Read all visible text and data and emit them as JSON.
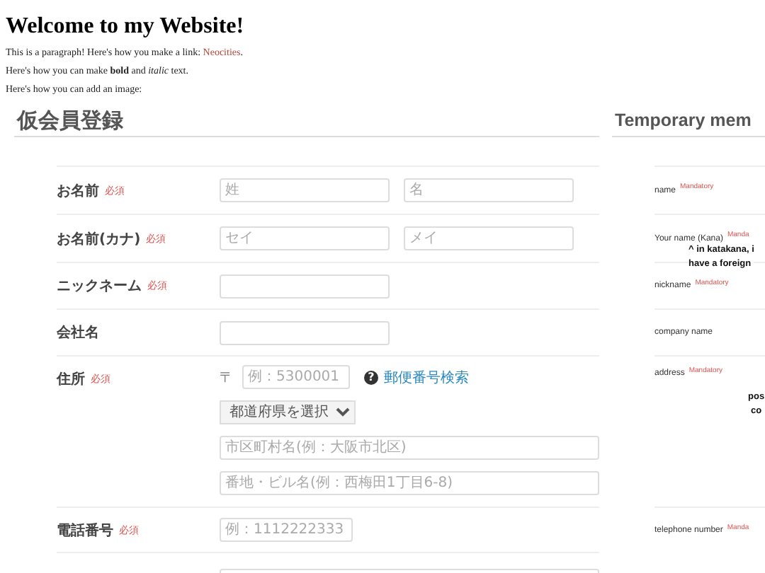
{
  "heading": "Welcome to my Website!",
  "intro": {
    "text": "This is a paragraph! Here's how you make a link: ",
    "link": "Neocities",
    "after": "."
  },
  "paragraphs": [
    "Here's how you can make **bold** and *italic* text.",
    "Here's how you can add an image:"
  ],
  "form_ja": {
    "title": "仮会員登録",
    "rows": [
      {
        "kind": "fields",
        "label": "お名前",
        "badge": "必須",
        "fields": [
          {
            "kind": "short",
            "placeholder": "姓"
          },
          {
            "kind": "short",
            "placeholder": "名"
          }
        ]
      },
      {
        "kind": "fields",
        "label": "お名前(カナ)",
        "badge": "必須",
        "fields": [
          {
            "kind": "short",
            "placeholder": "セイ"
          },
          {
            "kind": "short",
            "placeholder": "メイ"
          }
        ]
      },
      {
        "kind": "fields",
        "label": "ニックネーム",
        "badge": "必須",
        "fields": [
          {
            "kind": "short"
          }
        ]
      },
      {
        "kind": "fields",
        "label": "会社名",
        "fields": [
          {
            "kind": "short"
          }
        ]
      },
      {
        "kind": "address",
        "label": "住所",
        "badge": "必須",
        "postal_mark": "〒",
        "postal_placeholder": "例：5300001",
        "help_icon": "?",
        "help_link": "郵便番号検索",
        "select": "都道府県を選択",
        "fields": [
          {
            "kind": "long",
            "placeholder": "市区町村名(例：大阪市北区)"
          },
          {
            "kind": "long",
            "placeholder": "番地・ビル名(例：西梅田1丁目6-8)"
          }
        ]
      },
      {
        "kind": "fields",
        "label": "電話番号",
        "badge": "必須",
        "fields": [
          {
            "kind": "phone",
            "placeholder": "例：1112222333"
          }
        ]
      },
      {
        "kind": "fields",
        "fields": [
          {
            "kind": "long"
          }
        ]
      }
    ]
  },
  "form_en": {
    "title": "Temporary mem",
    "rows": [
      {
        "label": "name",
        "badge": "Mandatory"
      },
      {
        "label": "Your name (Kana)",
        "badge": "Manda",
        "note": [
          "^ in katakana, i",
          "have a foreign"
        ]
      },
      {
        "label": "nickname",
        "badge": "Mandatory"
      },
      {
        "label": "company name"
      },
      {
        "label": "address",
        "badge": "Mandatory",
        "note": [
          "pos",
          "co"
        ]
      },
      {
        "label": "telephone number",
        "badge": "Manda"
      }
    ]
  }
}
